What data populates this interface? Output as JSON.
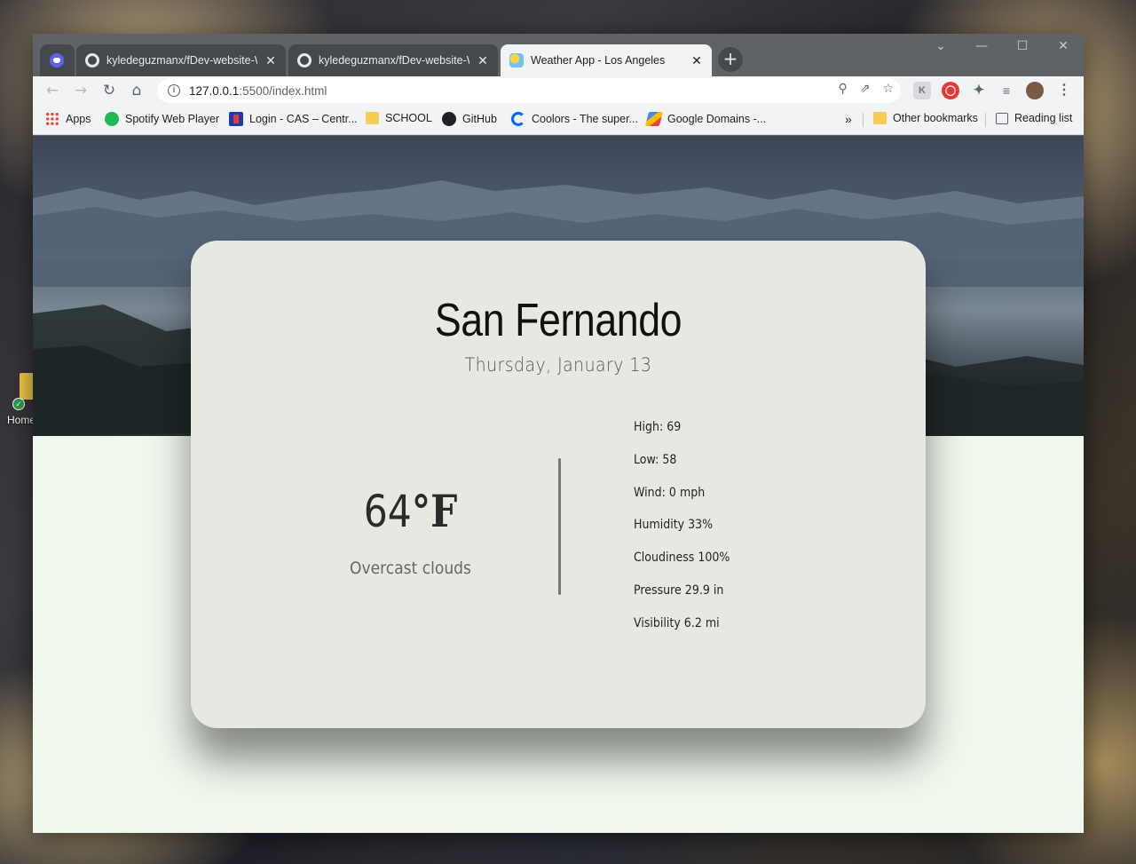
{
  "desktop": {
    "icon_label": "Home"
  },
  "browser": {
    "tabs": [
      {
        "title": "",
        "favicon": "discord-icon",
        "active": false
      },
      {
        "title": "kyledeguzmanx/fDev-website-W...",
        "favicon": "github-icon",
        "active": false
      },
      {
        "title": "kyledeguzmanx/fDev-website-W...",
        "favicon": "github-icon",
        "active": false
      },
      {
        "title": "Weather App - Los Angeles",
        "favicon": "weather-icon",
        "active": true
      }
    ],
    "new_tab_label": "+",
    "url_host": "127.0.0.1",
    "url_rest": ":5500/index.html",
    "bookmarks": [
      {
        "label": "Apps",
        "icon": "apps-grid-icon"
      },
      {
        "label": "Spotify Web Player",
        "icon": "spotify-icon"
      },
      {
        "label": "Login - CAS – Centr...",
        "icon": "cas-icon"
      },
      {
        "label": "SCHOOL",
        "icon": "folder-icon"
      },
      {
        "label": "GitHub",
        "icon": "github-icon"
      },
      {
        "label": "Coolors - The super...",
        "icon": "coolors-icon"
      },
      {
        "label": "Google Domains -...",
        "icon": "google-domains-icon"
      }
    ],
    "overflow_label": "»",
    "other_bookmarks": "Other bookmarks",
    "reading_list": "Reading list"
  },
  "weather": {
    "city": "San Fernando",
    "date": "Thursday, January 13",
    "temperature": "64",
    "unit": "°F",
    "description": "Overcast clouds",
    "details": [
      "High: 69",
      "Low: 58",
      "Wind: 0 mph",
      "Humidity 33%",
      "Cloudiness 100%",
      "Pressure 29.9 in",
      "Visibility 6.2 mi"
    ]
  },
  "colors": {
    "chrome_frame": "#5f6368",
    "toolbar": "#f1f3f4",
    "card_bg": "#e8e8e3",
    "page_bg": "#f0f8ee"
  }
}
